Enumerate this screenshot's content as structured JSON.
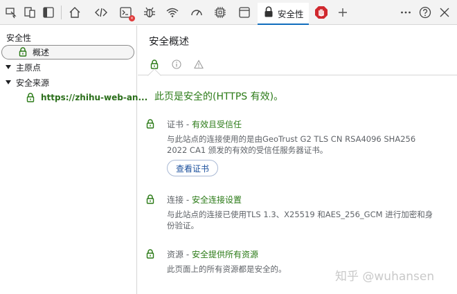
{
  "toolbar": {
    "icons": [
      "device-toggle-icon",
      "dock-icon",
      "sidebar-toggle-icon",
      "welcome-icon",
      "elements-icon",
      "console-icon",
      "sources-icon",
      "network-icon",
      "performance-icon",
      "memory-icon",
      "application-icon",
      "security-icon",
      "blocked-extension-icon",
      "add-tab-icon",
      "more-icon",
      "help-icon",
      "close-icon"
    ],
    "active_tab_label": "安全性",
    "console_badge": "×"
  },
  "sidebar": {
    "root_label": "安全性",
    "overview_label": "概述",
    "main_origin_label": "主原点",
    "secure_origins_label": "安全来源",
    "origin_link": "https://zhihu-web-an..."
  },
  "main": {
    "title": "安全概述",
    "headline": "此页是安全的(HTTPS 有效)。",
    "certificate": {
      "label": "证书",
      "status": "有效且受信任",
      "description": "与此站点的连接使用的是由GeoTrust G2 TLS CN RSA4096 SHA256 2022 CA1 颁发的有效的受信任服务器证书。",
      "button_label": "查看证书"
    },
    "connection": {
      "label": "连接",
      "status": "安全连接设置",
      "description": "与此站点的连接已使用TLS 1.3、X25519 和AES_256_GCM 进行加密和身份验证。"
    },
    "resources": {
      "label": "资源",
      "status": "安全提供所有资源",
      "description": "此页面上的所有资源都是安全的。"
    },
    "separator": " - "
  },
  "watermark": "知乎 @wuhansen",
  "colors": {
    "secure_green": "#2a7a16",
    "accent_blue": "#0f6cbd",
    "stop_red": "#d0282e"
  }
}
